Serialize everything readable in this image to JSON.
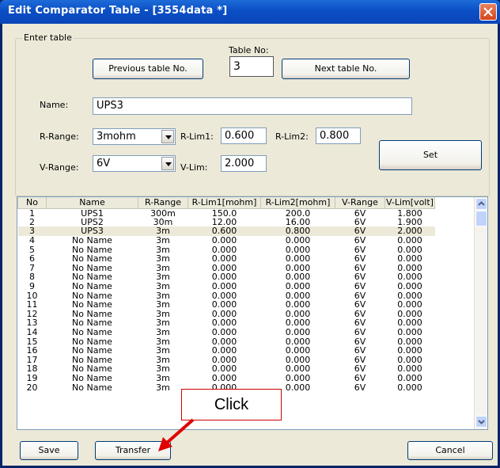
{
  "window": {
    "title": "Edit Comparator Table - [3554data *]"
  },
  "group": {
    "label": "Enter table"
  },
  "table_no": {
    "label": "Table No:",
    "value": "3"
  },
  "buttons": {
    "previous": "Previous table No.",
    "next": "Next table No.",
    "set": "Set",
    "save": "Save",
    "transfer": "Transfer",
    "cancel": "Cancel"
  },
  "name": {
    "label": "Name:",
    "value": "UPS3"
  },
  "r_range": {
    "label": "R-Range:",
    "value": "3mohm"
  },
  "r_lim1": {
    "label": "R-Lim1:",
    "value": "0.600"
  },
  "r_lim2": {
    "label": "R-Lim2:",
    "value": "0.800"
  },
  "v_range": {
    "label": "V-Range:",
    "value": "6V"
  },
  "v_lim": {
    "label": "V-Lim:",
    "value": "2.000"
  },
  "callout": {
    "text": "Click"
  },
  "colors": {
    "title_bar": "#0b4fc6",
    "close": "#d3451e",
    "callout_border": "#cc0000",
    "arrow": "#e00000"
  },
  "table": {
    "columns": [
      "No",
      "Name",
      "R-Range",
      "R-Lim1[mohm]",
      "R-Lim2[mohm]",
      "V-Range",
      "V-Lim[volt]"
    ],
    "selected_row": 3,
    "rows": [
      [
        "1",
        "UPS1",
        "300m",
        "150.0",
        "200.0",
        "6V",
        "1.800"
      ],
      [
        "2",
        "UPS2",
        "30m",
        "12.00",
        "16.00",
        "6V",
        "1.900"
      ],
      [
        "3",
        "UPS3",
        "3m",
        "0.600",
        "0.800",
        "6V",
        "2.000"
      ],
      [
        "4",
        "No Name",
        "3m",
        "0.000",
        "0.000",
        "6V",
        "0.000"
      ],
      [
        "5",
        "No Name",
        "3m",
        "0.000",
        "0.000",
        "6V",
        "0.000"
      ],
      [
        "6",
        "No Name",
        "3m",
        "0.000",
        "0.000",
        "6V",
        "0.000"
      ],
      [
        "7",
        "No Name",
        "3m",
        "0.000",
        "0.000",
        "6V",
        "0.000"
      ],
      [
        "8",
        "No Name",
        "3m",
        "0.000",
        "0.000",
        "6V",
        "0.000"
      ],
      [
        "9",
        "No Name",
        "3m",
        "0.000",
        "0.000",
        "6V",
        "0.000"
      ],
      [
        "10",
        "No Name",
        "3m",
        "0.000",
        "0.000",
        "6V",
        "0.000"
      ],
      [
        "11",
        "No Name",
        "3m",
        "0.000",
        "0.000",
        "6V",
        "0.000"
      ],
      [
        "12",
        "No Name",
        "3m",
        "0.000",
        "0.000",
        "6V",
        "0.000"
      ],
      [
        "13",
        "No Name",
        "3m",
        "0.000",
        "0.000",
        "6V",
        "0.000"
      ],
      [
        "14",
        "No Name",
        "3m",
        "0.000",
        "0.000",
        "6V",
        "0.000"
      ],
      [
        "15",
        "No Name",
        "3m",
        "0.000",
        "0.000",
        "6V",
        "0.000"
      ],
      [
        "16",
        "No Name",
        "3m",
        "0.000",
        "0.000",
        "6V",
        "0.000"
      ],
      [
        "17",
        "No Name",
        "3m",
        "0.000",
        "0.000",
        "6V",
        "0.000"
      ],
      [
        "18",
        "No Name",
        "3m",
        "0.000",
        "0.000",
        "6V",
        "0.000"
      ],
      [
        "19",
        "No Name",
        "3m",
        "0.000",
        "0.000",
        "6V",
        "0.000"
      ],
      [
        "20",
        "No Name",
        "3m",
        "0.000",
        "0.000",
        "6V",
        "0.000"
      ]
    ]
  }
}
